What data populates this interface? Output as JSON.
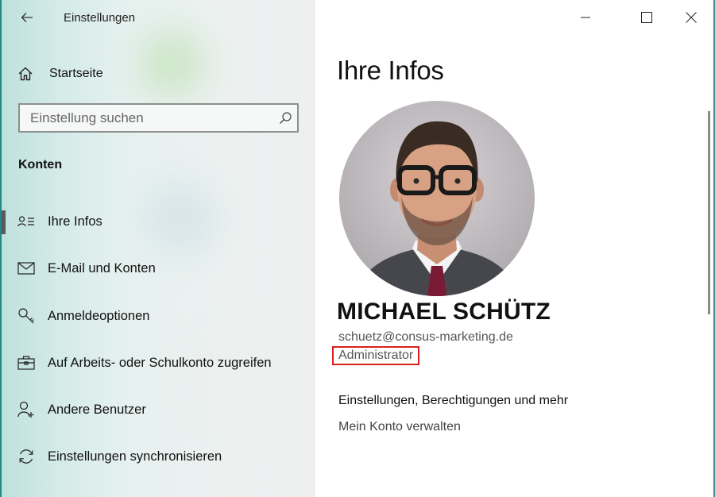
{
  "window": {
    "title": "Einstellungen",
    "controls": {
      "minimize": "minimize-icon",
      "maximize": "maximize-icon",
      "close": "close-icon"
    }
  },
  "sidebar": {
    "back_icon": "back-arrow-icon",
    "home": {
      "label": "Startseite",
      "icon": "home-icon"
    },
    "search": {
      "placeholder": "Einstellung suchen",
      "value": "",
      "icon": "search-icon"
    },
    "section_title": "Konten",
    "items": [
      {
        "label": "Ihre Infos",
        "icon": "person-card-icon",
        "selected": true
      },
      {
        "label": "E-Mail und Konten",
        "icon": "mail-icon",
        "selected": false
      },
      {
        "label": "Anmeldeoptionen",
        "icon": "key-icon",
        "selected": false
      },
      {
        "label": "Auf Arbeits- oder Schulkonto zugreifen",
        "icon": "briefcase-icon",
        "selected": false
      },
      {
        "label": "Andere Benutzer",
        "icon": "add-person-icon",
        "selected": false
      },
      {
        "label": "Einstellungen synchronisieren",
        "icon": "sync-icon",
        "selected": false
      }
    ]
  },
  "main": {
    "title": "Ihre Infos",
    "user": {
      "name": "MICHAEL SCHÜTZ",
      "email": "schuetz@consus-marketing.de",
      "role": "Administrator"
    },
    "settings_heading": "Einstellungen, Berechtigungen und mehr",
    "manage_link": "Mein Konto verwalten"
  },
  "colors": {
    "accent_edge": "#1f8a86",
    "highlight_box": "#d8211e",
    "selection_bar": "#5a5a5a"
  }
}
